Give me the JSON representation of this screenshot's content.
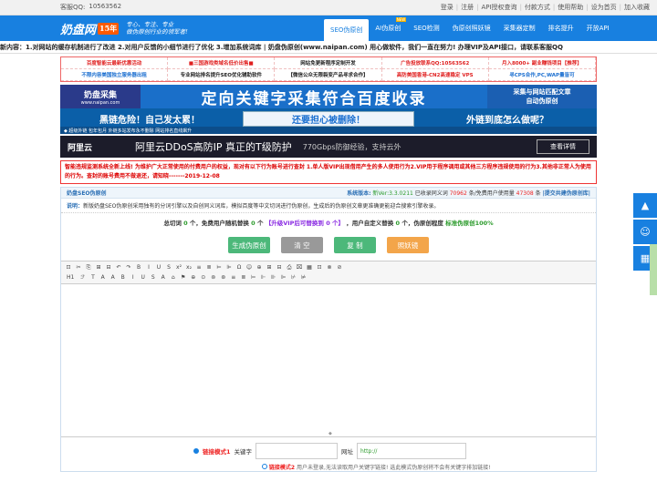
{
  "topbar": {
    "qq_label": "客服QQ:",
    "qq_number": "10563562",
    "links": [
      "登录",
      "注册",
      "API授权查询",
      "付款方式",
      "使用帮助",
      "设为首页",
      "加入收藏"
    ]
  },
  "header": {
    "logo_name": "奶盘网",
    "logo_badge": "15年",
    "slogan_line1": "专心、专注、专业",
    "slogan_line2": "做伪原创行业的领军者!",
    "nav": [
      {
        "label": "SEO伪原创",
        "active": true
      },
      {
        "label": "AI伪原创",
        "new": "NEW"
      },
      {
        "label": "SEO检测"
      },
      {
        "label": "伪原创照妖镜"
      },
      {
        "label": "采集器定制"
      },
      {
        "label": "排名提升"
      },
      {
        "label": "开放API"
      }
    ]
  },
  "notice": "新内容：1.对网站的缓存机制进行了改进 2.对用户反馈的小细节进行了优化 3.增加系统词库 | 奶盘伪原创(www.naipan.com) 用心做软件，我们一直在努力! 办理VIP及API接口，请联系客服QQ",
  "ads": [
    {
      "text": "百度智能云最新优惠活动",
      "color": "#e02020"
    },
    {
      "text": "■三国游戏类域名低价出售■",
      "color": "#e02020"
    },
    {
      "text": "网站免更新程序定制开发",
      "color": "#222222"
    },
    {
      "text": "广告投放联系QQ:10563562",
      "color": "#e02020"
    },
    {
      "text": "月入8000+ 副业赚钱项目【推荐】",
      "color": "#e02020"
    },
    {
      "text": "不限内容美国独立服务器出租",
      "color": "#1b6fd0"
    },
    {
      "text": "专业网站排名提升SEO优化辅助软件",
      "color": "#222222"
    },
    {
      "text": "【微信公众无限裂变产品寻求合作】",
      "color": "#222222"
    },
    {
      "text": "高防美国香港-CN2高速稳定 VPS",
      "color": "#e02020"
    },
    {
      "text": "寻CPS合作,PC,WAP量皆可",
      "color": "#1b6fd0"
    }
  ],
  "banner1": {
    "logo_title": "奶盘采集",
    "logo_sub": "www.naipan.com",
    "headline": "定向关键字采集符合百度收录",
    "side_line1": "采集与网站匹配文章",
    "side_line2": "自动伪原创"
  },
  "banner2": {
    "left": "黑链危险！自己发太累！",
    "mid": "还要担心被删除！",
    "right": "外链到底怎么做呢？"
  },
  "banner3": "◆ 超级外链 包年包月 外链多站发布永不删除 网站排名直线飙升",
  "aliyun": {
    "brand": "阿里云",
    "title": "阿里云DDoS高防IP 真正的T级防护",
    "sub": "770Gbps防御经验，支持云外",
    "button": "查看详情"
  },
  "warning": "智能违规监测系统全新上线! 为维护广大正常使用的付费用户的权益，现对有以下行为账号进行查封 1.单人版VIP出现借用产生的多人使用行为2.VIP用于程序调用或其他三方程序违规使用的行为3.其他非正常人为使用的行为。查封的账号费用不做退还，请知晓-------2019-12-08",
  "panel": {
    "title": "奶盘SEO伪原创",
    "version_label": "系统版本:",
    "version": "新Ver:3.3.0211",
    "indexed_label": "已收录同义词",
    "indexed": "70962",
    "indexed_unit": "条/免费用户使用量",
    "usage": "47308",
    "usage_unit": "条",
    "submit": "|提交共建伪原创库|"
  },
  "desc": {
    "label": "说明：",
    "text": "新版奶盘SEO伪原创采用独有的分词引擎以及自创同义词库，模拟百度等中文切词进行伪原创，生成后的伪原创文章更准确更能迎合搜索引擎收录。"
  },
  "counts": {
    "p1": "总切词",
    "total": "0",
    "p2": "个，免费用户随机替换",
    "random": "0",
    "p3": "个",
    "vip": "【升级VIP后可替换到 0 个】",
    "p4": "，用户自定义替换",
    "custom": "0",
    "p5": "个，伪原创程度",
    "level": "标准伪原创100%"
  },
  "actions": {
    "generate": "生成伪原创",
    "clear": "清 空",
    "copy": "复 制",
    "mirror": "照妖镜"
  },
  "toolbar": {
    "row1": [
      "⊡",
      "✂",
      "⎘",
      "⊞",
      "⊟",
      "↶",
      "↷",
      "B",
      "I",
      "U",
      "S",
      "x²",
      "x₂",
      "≡",
      "≣",
      "⊨",
      "⊫",
      "Ω",
      "☺",
      "⊕",
      "⊞",
      "⊟",
      "⎙",
      "⌧",
      "▦",
      "⊡",
      "⊗",
      "⊘"
    ],
    "row2_sel1": "H1",
    "row2_sel2": "ℱ",
    "row2_sel3": "T",
    "row2": [
      "A",
      "A",
      "B",
      "I",
      "U",
      "S",
      "A",
      "⌂",
      "⚑",
      "⊕",
      "⊙",
      "⊚",
      "⊛",
      "≡",
      "≣",
      "⊨",
      "⊩",
      "⊪",
      "⊫",
      "⊬",
      "⊭"
    ]
  },
  "link": {
    "mode1_label": "链接模式1",
    "keyword_label": "关键字",
    "keyword_value": "",
    "url_label": "网址",
    "url_value": "http://",
    "mode2_label": "链接模式2",
    "mode2_note": "用户未登录,无法读取用户关键字链接! 选此模式伪原创将不会有关键字排加链接!"
  }
}
